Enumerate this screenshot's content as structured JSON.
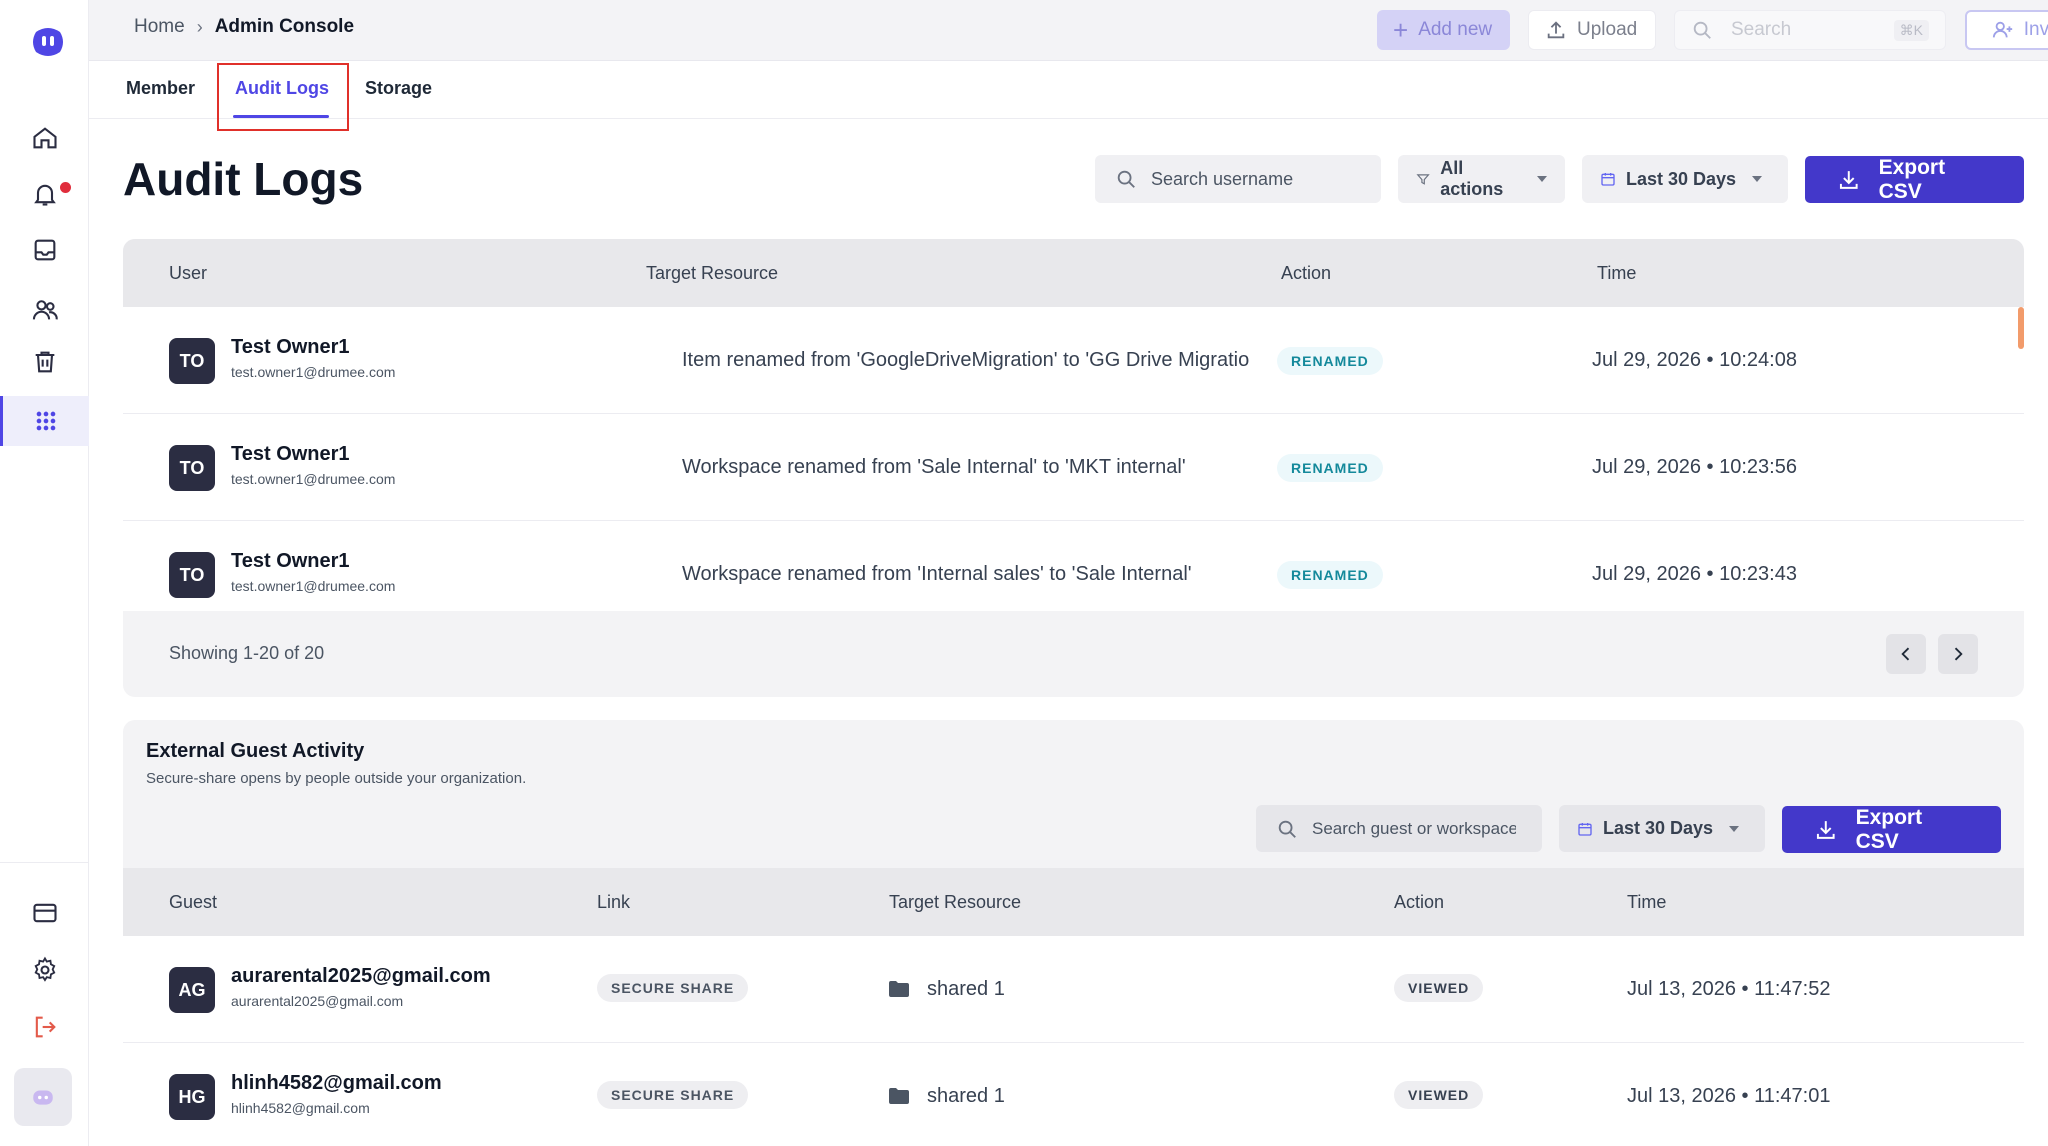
{
  "topbar": {
    "breadcrumb_home": "Home",
    "breadcrumb_sep": "›",
    "breadcrumb_current": "Admin Console",
    "add_new_label": "Add new",
    "upload_label": "Upload",
    "search_placeholder": "Search",
    "search_shortcut": "⌘K",
    "invite_label": "Invite"
  },
  "tabs": [
    {
      "label": "Member"
    },
    {
      "label": "Audit Logs",
      "active": true
    },
    {
      "label": "Storage"
    }
  ],
  "audit": {
    "title": "Audit Logs",
    "search_placeholder": "Search username",
    "actions_filter": "All actions",
    "date_filter": "Last 30 Days",
    "export_label": "Export CSV",
    "columns": [
      "User",
      "Target Resource",
      "Action",
      "Time"
    ],
    "rows": [
      {
        "initials": "TO",
        "name": "Test Owner1",
        "email": "test.owner1@drumee.com",
        "target": "Item renamed from 'GoogleDriveMigration' to 'GG Drive Migratio",
        "action": "RENAMED",
        "time": "Jul 29, 2026 • 10:24:08"
      },
      {
        "initials": "TO",
        "name": "Test Owner1",
        "email": "test.owner1@drumee.com",
        "target": "Workspace renamed from 'Sale Internal' to 'MKT internal'",
        "action": "RENAMED",
        "time": "Jul 29, 2026 • 10:23:56"
      },
      {
        "initials": "TO",
        "name": "Test Owner1",
        "email": "test.owner1@drumee.com",
        "target": "Workspace renamed from 'Internal sales' to 'Sale Internal'",
        "action": "RENAMED",
        "time": "Jul 29, 2026 • 10:23:43"
      }
    ],
    "showing": "Showing 1-20 of 20"
  },
  "guest": {
    "title": "External Guest Activity",
    "subtitle": "Secure-share opens by people outside your organization.",
    "search_placeholder": "Search guest or workspace",
    "date_filter": "Last 30 Days",
    "export_label": "Export CSV",
    "columns": [
      "Guest",
      "Link",
      "Target Resource",
      "Action",
      "Time"
    ],
    "rows": [
      {
        "initials": "AG",
        "name": "aurarental2025@gmail.com",
        "email": "aurarental2025@gmail.com",
        "link": "SECURE SHARE",
        "target": "shared 1",
        "action": "VIEWED",
        "time": "Jul 13, 2026 • 11:47:52"
      },
      {
        "initials": "HG",
        "name": "hlinh4582@gmail.com",
        "email": "hlinh4582@gmail.com",
        "link": "SECURE SHARE",
        "target": "shared 1",
        "action": "VIEWED",
        "time": "Jul 13, 2026 • 11:47:01"
      }
    ]
  },
  "colors": {
    "accent": "#4338ca",
    "tab_active": "#4f46e5",
    "tab_highlight_border": "#e0302a",
    "notification_dot": "#e02d3c",
    "renamed_badge_text": "#14899b"
  }
}
